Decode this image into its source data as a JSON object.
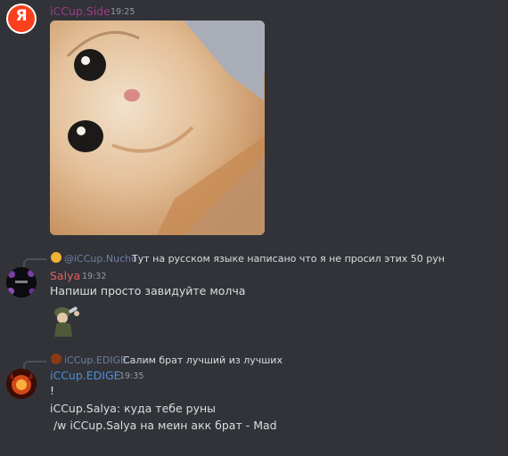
{
  "messages": [
    {
      "username": "iCCup.Side",
      "username_color": "#a3398a",
      "timestamp": "19:25",
      "avatar_letter": "Я",
      "attachment": "cat-photo"
    },
    {
      "reply": {
        "mention": "@iCCup.Nucho",
        "text": "Тут на русском языке написано что я не просил этих 50 рун"
      },
      "username": "Salya",
      "username_color": "#e45f5f",
      "timestamp": "19:32",
      "text": "Напиши просто завидуйте молча",
      "attachment": "sticker"
    },
    {
      "reply": {
        "mention": "iCCup.EDIGE",
        "text": "Салим брат лучший из лучших"
      },
      "username": "iCCup.EDIGE",
      "username_color": "#4f8ed6",
      "timestamp": "19:35",
      "lines": [
        "!",
        "iCCup.Salya: куда тебе руны",
        " /w iCCup.Salya на меин акк брат - Mad"
      ]
    }
  ]
}
